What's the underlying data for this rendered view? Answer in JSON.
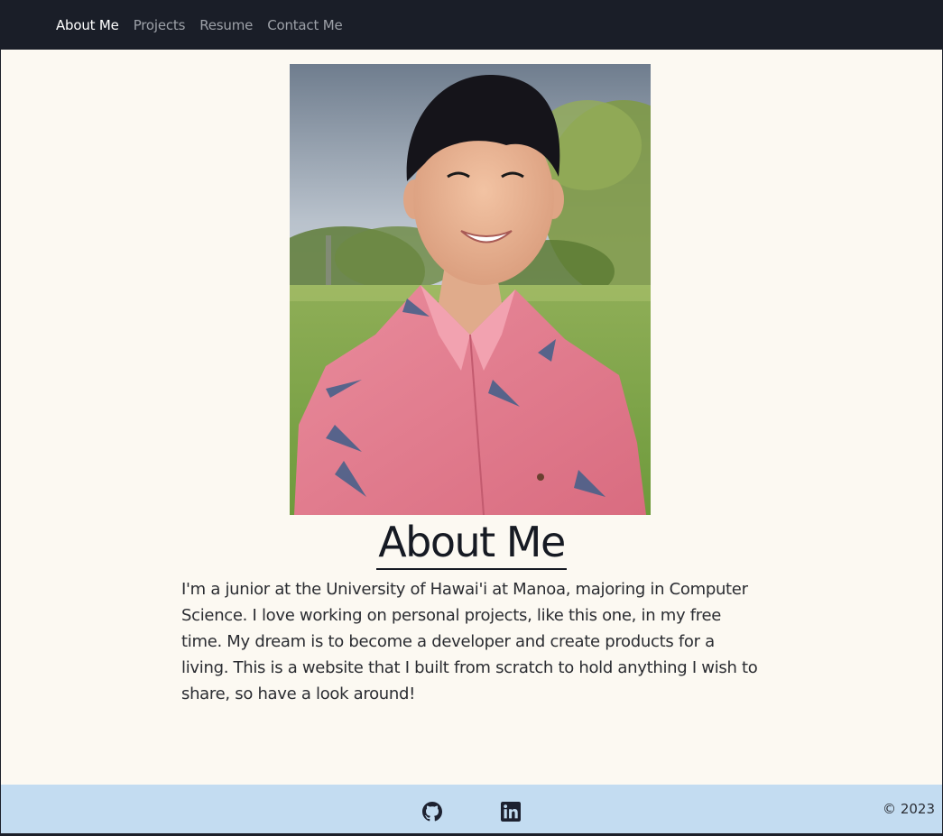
{
  "nav": {
    "items": [
      {
        "label": "About Me",
        "active": true
      },
      {
        "label": "Projects",
        "active": false
      },
      {
        "label": "Resume",
        "active": false
      },
      {
        "label": "Contact Me",
        "active": false
      }
    ]
  },
  "main": {
    "heading": "About Me",
    "bio": "I'm a junior at the University of Hawai'i at Manoa, majoring in Computer Science. I love working on personal projects, like this one, in my free time. My dream is to become a developer and create products for a living. This is a website that I built from scratch to hold anything I wish to share, so have a look around!"
  },
  "footer": {
    "icons": [
      "github-icon",
      "linkedin-icon"
    ],
    "copyright": "© 2023"
  },
  "colors": {
    "navbar": "#1a1e28",
    "page": "#fcf9f2",
    "footer": "#c3dcf1",
    "text": "#161a23"
  }
}
